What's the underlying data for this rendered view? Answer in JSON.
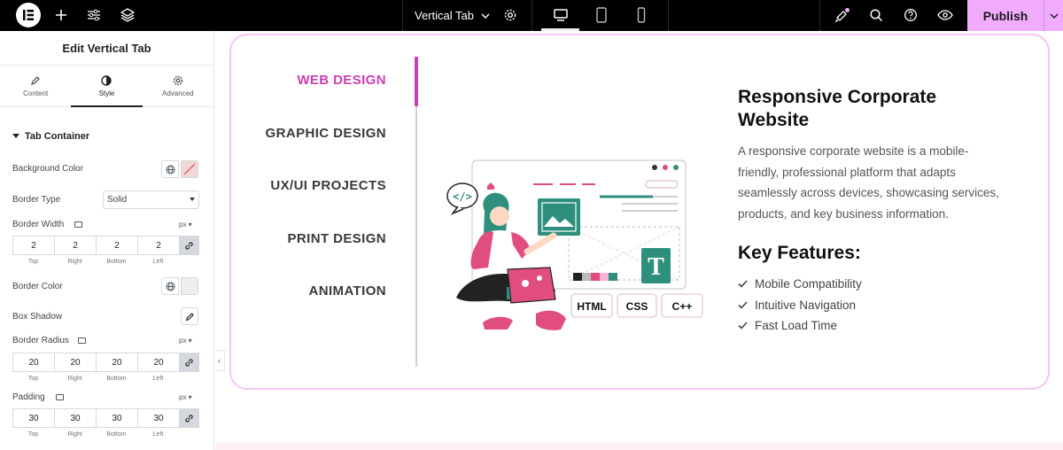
{
  "topbar": {
    "page_title": "Vertical Tab",
    "publish_label": "Publish"
  },
  "panel": {
    "title": "Edit Vertical Tab",
    "tabs": [
      {
        "label": "Content",
        "icon": "pencil-icon"
      },
      {
        "label": "Style",
        "icon": "contrast-icon"
      },
      {
        "label": "Advanced",
        "icon": "gear-icon"
      }
    ],
    "section_title": "Tab Container",
    "background_color_label": "Background Color",
    "border_type_label": "Border Type",
    "border_type_value": "Solid",
    "border_width_label": "Border Width",
    "border_width_unit": "px",
    "border_width": {
      "top": "2",
      "right": "2",
      "bottom": "2",
      "left": "2"
    },
    "border_color_label": "Border Color",
    "box_shadow_label": "Box Shadow",
    "border_radius_label": "Border Radius",
    "border_radius_unit": "px",
    "border_radius": {
      "top": "20",
      "right": "20",
      "bottom": "20",
      "left": "20"
    },
    "padding_label": "Padding",
    "padding_unit": "px",
    "padding": {
      "top": "30",
      "right": "30",
      "bottom": "30",
      "left": "30"
    },
    "dim_labels": {
      "top": "Top",
      "right": "Right",
      "bottom": "Bottom",
      "left": "Left"
    }
  },
  "preview": {
    "tabs": [
      "WEB DESIGN",
      "GRAPHIC DESIGN",
      "UX/UI PROJECTS",
      "PRINT DESIGN",
      "ANIMATION"
    ],
    "active_tab_index": 0,
    "heading": "Responsive Corporate Website",
    "description": "A responsive corporate website is a mobile-friendly, professional platform that adapts seamlessly across devices, showcasing services, products, and key business information.",
    "features_title": "Key Features:",
    "features": [
      "Mobile Compatibility",
      "Intuitive Navigation",
      "Fast Load Time"
    ],
    "illustration_labels": {
      "html": "HTML",
      "css": "CSS",
      "cpp": "C++",
      "code": "</>",
      "font": "T"
    }
  },
  "colors": {
    "accent": "#cc3fb1",
    "publish_bg": "#f0abfc",
    "widget_border": "#f2c6f5"
  }
}
